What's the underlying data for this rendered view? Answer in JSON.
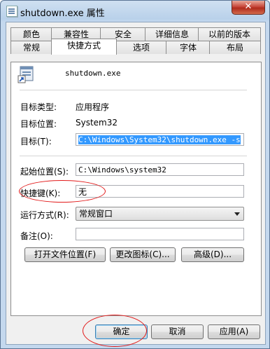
{
  "window": {
    "title": "shutdown.exe 属性",
    "close_glyph": "✕"
  },
  "tabs_back": [
    "颜色",
    "兼容性",
    "安全",
    "详细信息",
    "以前的版本"
  ],
  "tabs_front": [
    "常规",
    "快捷方式",
    "选项",
    "字体",
    "布局"
  ],
  "active_tab": "快捷方式",
  "shortcut": {
    "name": "shutdown.exe",
    "target_type_label": "目标类型:",
    "target_type_value": "应用程序",
    "target_location_label": "目标位置:",
    "target_location_value": "System32",
    "target_label": "目标(T):",
    "target_value": "C:\\Windows\\System32\\shutdown.exe -s",
    "start_in_label": "起始位置(S):",
    "start_in_value": "C:\\Windows\\system32",
    "hotkey_label": "快捷键(K):",
    "hotkey_value": "无",
    "run_label": "运行方式(R):",
    "run_value": "常规窗口",
    "comment_label": "备注(O):",
    "comment_value": ""
  },
  "buttons": {
    "open_location": "打开文件位置(F)",
    "change_icon": "更改图标(C)...",
    "advanced": "高级(D)..."
  },
  "dialog_buttons": {
    "ok": "确定",
    "cancel": "取消",
    "apply": "应用(A)"
  },
  "annotation_color": "#e21a1a"
}
